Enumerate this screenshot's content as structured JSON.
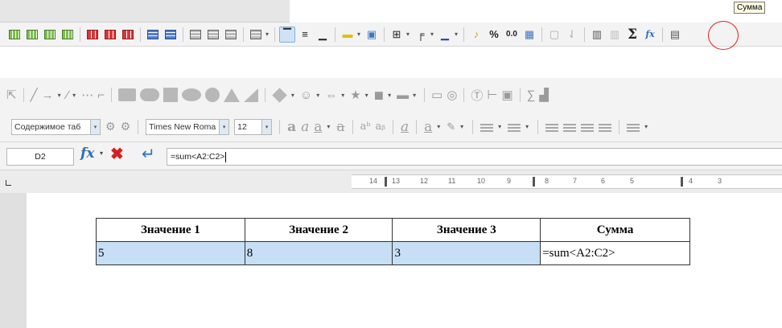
{
  "tooltip": "Сумма",
  "icons": {
    "sum": "summation-sigma-icon",
    "circle_color": "#e02020"
  },
  "format_toolbar": {
    "paragraph_style": "Содержимое таб",
    "font_name": "Times New Roma",
    "font_size": "12"
  },
  "formula_bar": {
    "cell_ref": "D2",
    "formula": "=sum<A2:C2>"
  },
  "ruler": {
    "ticks": [
      "14",
      "13",
      "12",
      "11",
      "10",
      "9",
      "8",
      "7",
      "6",
      "5",
      "4",
      "3"
    ]
  },
  "table": {
    "headers": [
      "Значение 1",
      "Значение 2",
      "Значение 3",
      "Сумма"
    ],
    "rows": [
      [
        "5",
        "8",
        "3",
        "=sum<A2:C2>"
      ]
    ],
    "highlight_color": "#c6dff4"
  }
}
